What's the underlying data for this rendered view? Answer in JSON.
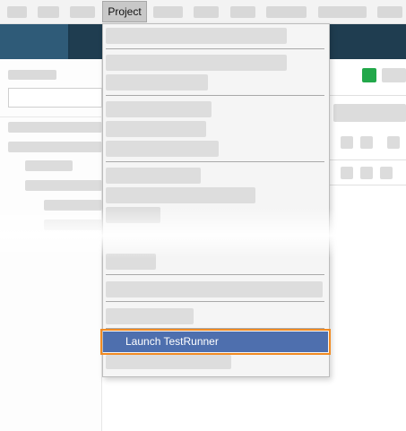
{
  "menubar": {
    "project_label": "Project"
  },
  "dropdown": {
    "highlighted_item_label": "Launch TestRunner"
  },
  "colors": {
    "highlight_background": "#4e6fae",
    "highlight_outline": "#f28b22",
    "ribbon": "#1f3d50",
    "status_green": "#22a84a"
  }
}
